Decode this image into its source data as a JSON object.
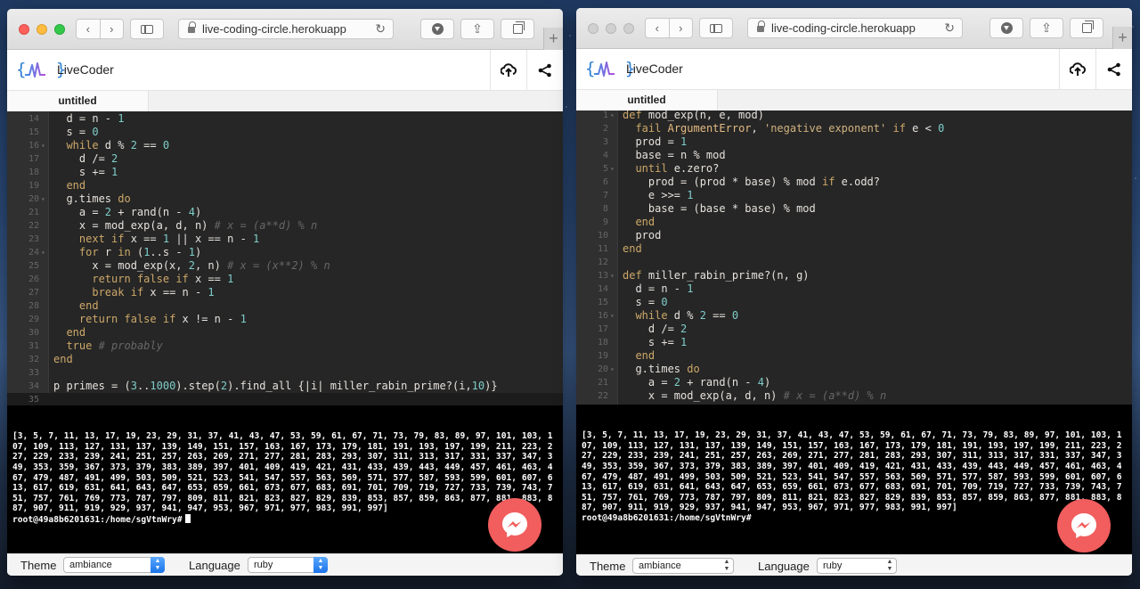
{
  "colors": {
    "accent": "#2d7fd3",
    "fab": "#f25d5d",
    "editor_bg": "#262626",
    "terminal_bg": "#000000",
    "select_arrow": "#1a73e8"
  },
  "windows": [
    {
      "id": "left",
      "active": true,
      "url": "live-coding-circle.herokuapp",
      "app_name": "LiveCoder",
      "file_tab": "untitled",
      "code_lines": [
        {
          "n": "14",
          "html": "  d = n - <span class=\"nm\">1</span>"
        },
        {
          "n": "15",
          "html": "  s = <span class=\"nm\">0</span>"
        },
        {
          "n": "16",
          "fold": true,
          "html": "  <span class=\"kw\">while</span> d % <span class=\"nm\">2</span> == <span class=\"nm\">0</span>"
        },
        {
          "n": "17",
          "html": "    d /= <span class=\"nm\">2</span>"
        },
        {
          "n": "18",
          "html": "    s += <span class=\"nm\">1</span>"
        },
        {
          "n": "19",
          "html": "  <span class=\"kw\">end</span>"
        },
        {
          "n": "20",
          "fold": true,
          "html": "  g.times <span class=\"kw\">do</span>"
        },
        {
          "n": "21",
          "html": "    a = <span class=\"nm\">2</span> + rand(n - <span class=\"nm\">4</span>)"
        },
        {
          "n": "22",
          "html": "    x = mod_exp(a, d, n) <span class=\"cm\"># x = (a**d) % n</span>"
        },
        {
          "n": "23",
          "html": "    <span class=\"kw\">next</span> <span class=\"kw\">if</span> x == <span class=\"nm\">1</span> || x == n - <span class=\"nm\">1</span>"
        },
        {
          "n": "24",
          "fold": true,
          "html": "    <span class=\"kw\">for</span> r <span class=\"kw\">in</span> (<span class=\"nm\">1</span>..s - <span class=\"nm\">1</span>)"
        },
        {
          "n": "25",
          "html": "      x = mod_exp(x, <span class=\"nm\">2</span>, n) <span class=\"cm\"># x = (x**2) % n</span>"
        },
        {
          "n": "26",
          "html": "      <span class=\"kw\">return</span> <span class=\"kw\">false</span> <span class=\"kw\">if</span> x == <span class=\"nm\">1</span>"
        },
        {
          "n": "27",
          "html": "      <span class=\"kw\">break</span> <span class=\"kw\">if</span> x == n - <span class=\"nm\">1</span>"
        },
        {
          "n": "28",
          "html": "    <span class=\"kw\">end</span>"
        },
        {
          "n": "29",
          "html": "    <span class=\"kw\">return</span> <span class=\"kw\">false</span> <span class=\"kw\">if</span> x != n - <span class=\"nm\">1</span>"
        },
        {
          "n": "30",
          "html": "  <span class=\"kw\">end</span>"
        },
        {
          "n": "31",
          "html": "  <span class=\"kw\">true</span> <span class=\"cm\"># probably</span>"
        },
        {
          "n": "32",
          "html": "<span class=\"kw\">end</span>"
        },
        {
          "n": "33",
          "html": ""
        },
        {
          "n": "34",
          "html": "p primes = (<span class=\"nm\">3</span>..<span class=\"nm\">1000</span>).step(<span class=\"nm\">2</span>).find_all {|i| miller_rabin_prime?(i,<span class=\"nm\">10</span>)}"
        },
        {
          "n": "35",
          "cur": true,
          "html": ""
        }
      ],
      "terminal_output": "[3, 5, 7, 11, 13, 17, 19, 23, 29, 31, 37, 41, 43, 47, 53, 59, 61, 67, 71, 73, 79, 83, 89, 97, 101, 103, 107, 109, 113, 127, 131, 137, 139, 149, 151, 157, 163, 167, 173, 179, 181, 191, 193, 197, 199, 211, 223, 227, 229, 233, 239, 241, 251, 257, 263, 269, 271, 277, 281, 283, 293, 307, 311, 313, 317, 331, 337, 347, 349, 353, 359, 367, 373, 379, 383, 389, 397, 401, 409, 419, 421, 431, 433, 439, 443, 449, 457, 461, 463, 467, 479, 487, 491, 499, 503, 509, 521, 523, 541, 547, 557, 563, 569, 571, 577, 587, 593, 599, 601, 607, 613, 617, 619, 631, 641, 643, 647, 653, 659, 661, 673, 677, 683, 691, 701, 709, 719, 727, 733, 739, 743, 751, 757, 761, 769, 773, 787, 797, 809, 811, 821, 823, 827, 829, 839, 853, 857, 859, 863, 877, 881, 883, 887, 907, 911, 919, 929, 937, 941, 947, 953, 967, 971, 977, 983, 991, 997]",
      "prompt": "root@49a8b6201631:/home/sgVtnWry#",
      "show_cursor": true,
      "theme_label": "Theme",
      "theme_value": "ambiance",
      "language_label": "Language",
      "language_value": "ruby"
    },
    {
      "id": "right",
      "active": false,
      "url": "live-coding-circle.herokuapp",
      "app_name": "LiveCoder",
      "file_tab": "untitled",
      "code_lines": [
        {
          "n": "1",
          "fold": true,
          "html": "<span class=\"kw\">def</span> mod_exp(n, e, mod)"
        },
        {
          "n": "2",
          "html": "  <span class=\"kw\">fail</span> <span class=\"cn\">ArgumentError</span>, <span class=\"str\">'negative exponent'</span> <span class=\"kw\">if</span> e &lt; <span class=\"nm\">0</span>"
        },
        {
          "n": "3",
          "html": "  prod = <span class=\"nm\">1</span>"
        },
        {
          "n": "4",
          "html": "  base = n % mod"
        },
        {
          "n": "5",
          "fold": true,
          "html": "  <span class=\"kw\">until</span> e.zero?"
        },
        {
          "n": "6",
          "html": "    prod = (prod * base) % mod <span class=\"kw\">if</span> e.odd?"
        },
        {
          "n": "7",
          "html": "    e &gt;&gt;= <span class=\"nm\">1</span>"
        },
        {
          "n": "8",
          "html": "    base = (base * base) % mod"
        },
        {
          "n": "9",
          "html": "  <span class=\"kw\">end</span>"
        },
        {
          "n": "10",
          "html": "  prod"
        },
        {
          "n": "11",
          "html": "<span class=\"kw\">end</span>"
        },
        {
          "n": "12",
          "html": ""
        },
        {
          "n": "13",
          "fold": true,
          "html": "<span class=\"kw\">def</span> miller_rabin_prime?(n, g)"
        },
        {
          "n": "14",
          "html": "  d = n - <span class=\"nm\">1</span>"
        },
        {
          "n": "15",
          "html": "  s = <span class=\"nm\">0</span>"
        },
        {
          "n": "16",
          "fold": true,
          "html": "  <span class=\"kw\">while</span> d % <span class=\"nm\">2</span> == <span class=\"nm\">0</span>"
        },
        {
          "n": "17",
          "html": "    d /= <span class=\"nm\">2</span>"
        },
        {
          "n": "18",
          "html": "    s += <span class=\"nm\">1</span>"
        },
        {
          "n": "19",
          "html": "  <span class=\"kw\">end</span>"
        },
        {
          "n": "20",
          "fold": true,
          "html": "  g.times <span class=\"kw\">do</span>"
        },
        {
          "n": "21",
          "html": "    a = <span class=\"nm\">2</span> + rand(n - <span class=\"nm\">4</span>)"
        },
        {
          "n": "22",
          "html": "    x = mod_exp(a, d, n) <span class=\"cm\"># x = (a**d) % n</span>"
        }
      ],
      "terminal_output": "[3, 5, 7, 11, 13, 17, 19, 23, 29, 31, 37, 41, 43, 47, 53, 59, 61, 67, 71, 73, 79, 83, 89, 97, 101, 103, 107, 109, 113, 127, 131, 137, 139, 149, 151, 157, 163, 167, 173, 179, 181, 191, 193, 197, 199, 211, 223, 227, 229, 233, 239, 241, 251, 257, 263, 269, 271, 277, 281, 283, 293, 307, 311, 313, 317, 331, 337, 347, 349, 353, 359, 367, 373, 379, 383, 389, 397, 401, 409, 419, 421, 431, 433, 439, 443, 449, 457, 461, 463, 467, 479, 487, 491, 499, 503, 509, 521, 523, 541, 547, 557, 563, 569, 571, 577, 587, 593, 599, 601, 607, 613, 617, 619, 631, 641, 643, 647, 653, 659, 661, 673, 677, 683, 691, 701, 709, 719, 727, 733, 739, 743, 751, 757, 761, 769, 773, 787, 797, 809, 811, 821, 823, 827, 829, 839, 853, 857, 859, 863, 877, 881, 883, 887, 907, 911, 919, 929, 937, 941, 947, 953, 967, 971, 977, 983, 991, 997]",
      "prompt": "root@49a8b6201631:/home/sgVtnWry#",
      "show_cursor": false,
      "theme_label": "Theme",
      "theme_value": "ambiance",
      "language_label": "Language",
      "language_value": "ruby"
    }
  ]
}
